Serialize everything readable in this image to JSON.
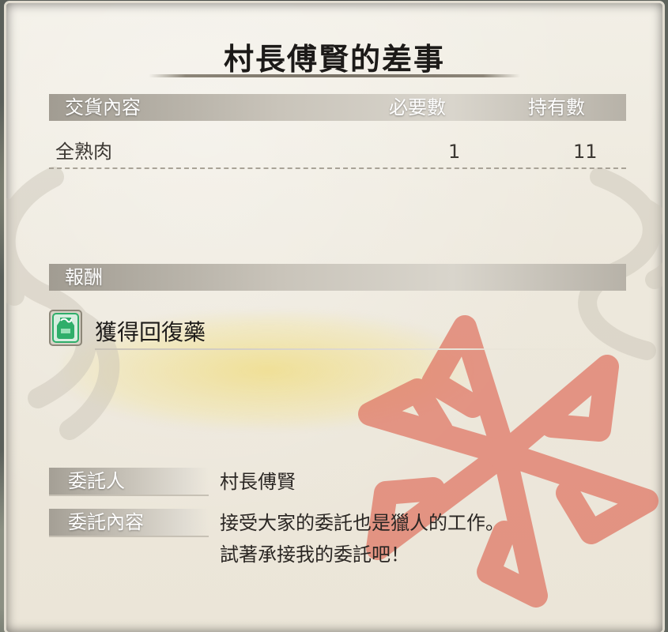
{
  "quest": {
    "title": "村長傅賢的差事"
  },
  "delivery": {
    "headers": {
      "item": "交貨內容",
      "required": "必要數",
      "owned": "持有數"
    },
    "rows": [
      {
        "item": "全熟肉",
        "required": "1",
        "owned": "11"
      }
    ]
  },
  "reward": {
    "header": "報酬",
    "items": [
      {
        "name": "獲得回復藥",
        "icon": "potion-icon",
        "icon_color": "#2fae6a"
      }
    ]
  },
  "client": {
    "label": "委託人",
    "value": "村長傅賢"
  },
  "request": {
    "label": "委託內容",
    "lines": [
      "接受大家的委託也是獵人的工作。",
      "試著承接我的委託吧！"
    ]
  },
  "colors": {
    "emblem_red": "#e07866",
    "accent_yellow": "#f0d75a",
    "bar_grey": "#b7b2a8"
  }
}
